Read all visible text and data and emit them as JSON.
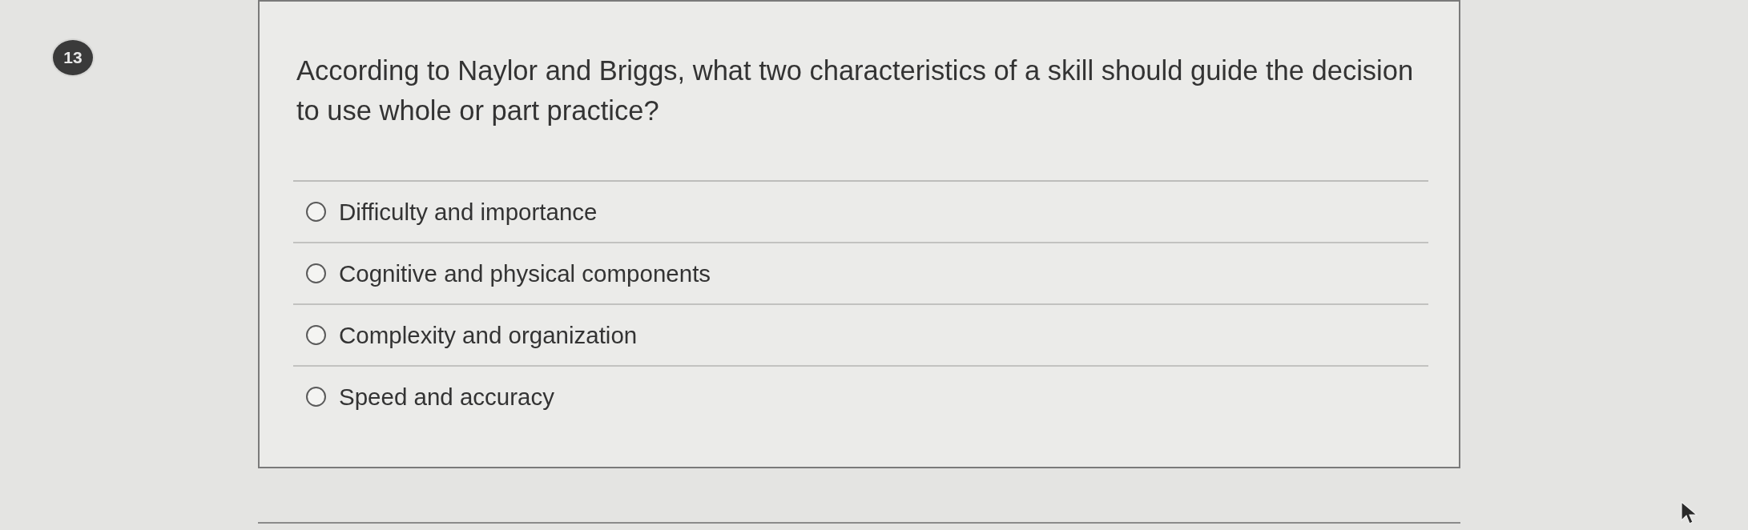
{
  "question": {
    "number": "13",
    "text": "According to Naylor and Briggs, what two characteristics of a skill should guide the decision to use whole or part practice?"
  },
  "options": [
    {
      "label": "Difficulty and importance",
      "selected": false
    },
    {
      "label": "Cognitive and physical components",
      "selected": false
    },
    {
      "label": "Complexity and organization",
      "selected": false
    },
    {
      "label": "Speed and accuracy",
      "selected": false
    }
  ]
}
